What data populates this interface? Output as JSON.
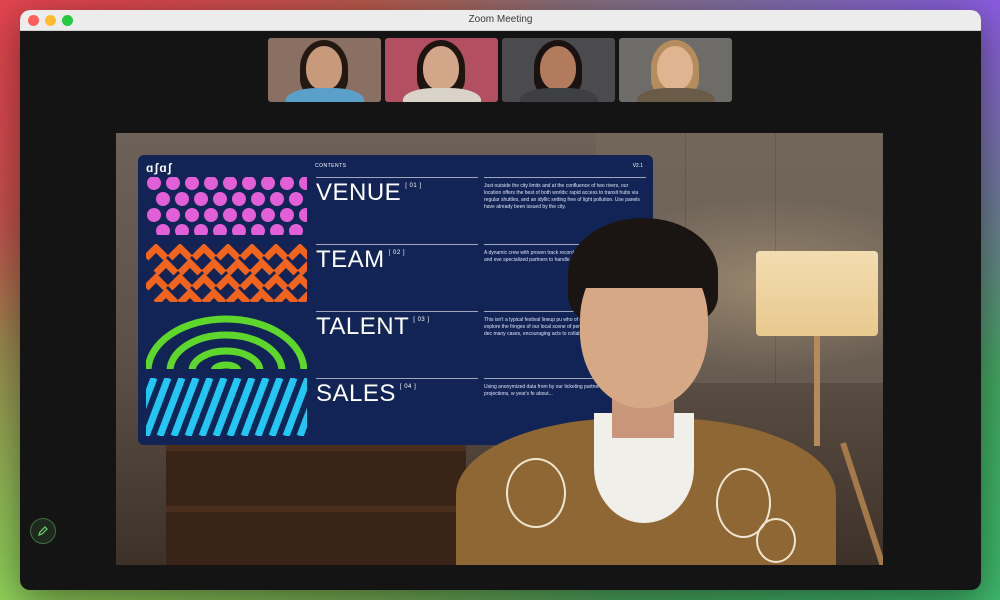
{
  "window": {
    "title": "Zoom Meeting"
  },
  "colors": {
    "slide_bg": "#122456",
    "pink": "#e25fd8",
    "orange": "#f2641d",
    "green": "#5fd62b",
    "cyan": "#20c8f2"
  },
  "participants": [
    {
      "bg": "#8a7062",
      "hair": "#231812",
      "skin": "#c89a7b",
      "shirt": "#5aa0c8"
    },
    {
      "bg": "#b25061",
      "hair": "#1e1410",
      "skin": "#d3a68a",
      "shirt": "#d9d3c9"
    },
    {
      "bg": "#4b4a4e",
      "hair": "#1a1210",
      "skin": "#b27b5e",
      "shirt": "#3e3f43"
    },
    {
      "bg": "#6e6c69",
      "hair": "#b48c5e",
      "skin": "#e0b391",
      "shirt": "#6a5b49"
    }
  ],
  "slide": {
    "logo": "ɑʃɑʃ",
    "contents_label": "CONTENTS",
    "version": "V2.1",
    "sections": [
      {
        "title": "VENUE",
        "num": "[ 01 ]",
        "text": "Just outside the city limits and at the confluence of two rivers, our location offers the best of both worlds: rapid access to transit hubs via regular shuttles, and an idyllic setting free of light pollution. Use panels have already been issued by the city."
      },
      {
        "title": "TEAM",
        "num": "[ 02 ]",
        "text": "A dynamic crew with proven track record production, cultural curation, and eve specialized partners to handle ticketin and health and safety."
      },
      {
        "title": "TALENT",
        "num": "[ 03 ]",
        "text": "This isn't a typical festival lineup pu who of chart-toppers. Our curatorial explore the fringes of our local scene of performers spanning genres and dec many cases, encouraging acts to collab one-off performances."
      },
      {
        "title": "SALES",
        "num": "[ 04 ]",
        "text": "Using anonymized data from by our ticketing partner without any addition projections, w year's fe about..."
      }
    ]
  },
  "controls": {
    "edit_icon": "pencil-icon"
  }
}
